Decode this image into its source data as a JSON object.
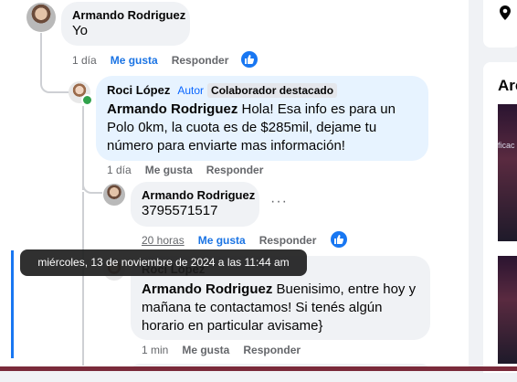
{
  "comments": [
    {
      "author": "Armando Rodriguez",
      "text": "Yo",
      "time": "1 día",
      "like": "Me gusta",
      "reply": "Responder"
    },
    {
      "author": "Roci López",
      "author_tag": "Autor",
      "badge": "Colaborador destacado",
      "mention": "Armando Rodriguez",
      "text": " Hola! Esa info es para un Polo 0km, la cuota es de $285mil, dejame tu número para enviarte mas información!",
      "time": "1 día",
      "like": "Me gusta",
      "reply": "Responder"
    },
    {
      "author": "Armando Rodriguez",
      "text": "3795571517",
      "time": "20 horas",
      "like": "Me gusta",
      "reply": "Responder",
      "more": "···"
    },
    {
      "author": "Roci López",
      "mention": "Armando Rodriguez",
      "text": " Buenisimo, entre hoy y mañana te contactamos! Si tenés algún horario en particular avisame}",
      "time": "1 min",
      "like": "Me gusta",
      "reply": "Responder"
    }
  ],
  "tooltip": "miércoles, 13 de noviembre de 2024 a las 11:44 am",
  "sidebar": {
    "card_title": "Arc",
    "thumb_text": "ficac"
  },
  "icons": {
    "reaction": "like-reaction-icon",
    "location": "location-pin-icon"
  },
  "colors": {
    "accent": "#1877f2",
    "author_tag": "#0866ff",
    "online": "#31a24c"
  }
}
